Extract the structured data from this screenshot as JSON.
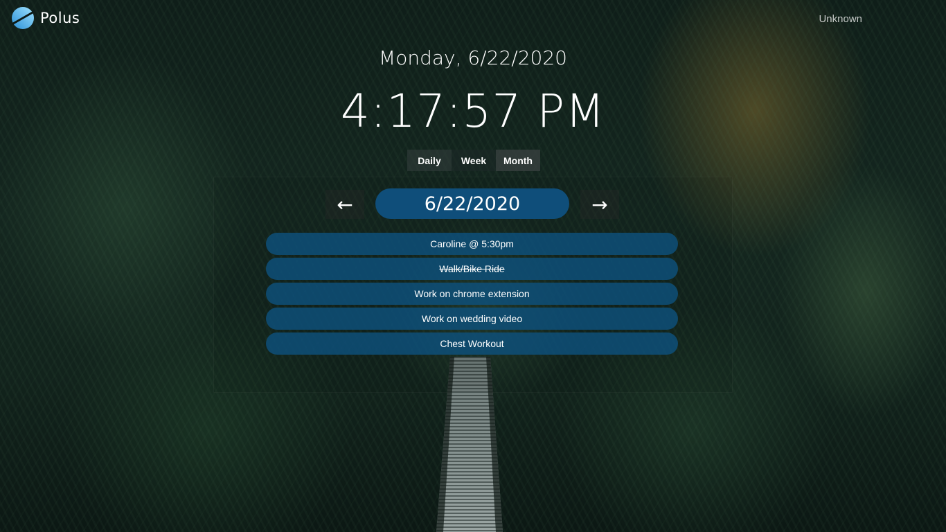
{
  "app": {
    "name": "Polus"
  },
  "user": {
    "name": "Unknown"
  },
  "datetime": {
    "date_line": "Monday, 6/22/2020",
    "time": "4:17:57 PM"
  },
  "view_tabs": [
    {
      "label": "Daily",
      "active": true
    },
    {
      "label": "Week",
      "active": false
    },
    {
      "label": "Month",
      "active": false
    }
  ],
  "navigator": {
    "prev_glyph": "←",
    "next_glyph": "→",
    "current_date": "6/22/2020"
  },
  "tasks": [
    {
      "label": "Caroline @ 5:30pm",
      "done": false
    },
    {
      "label": "Walk/Bike Ride",
      "done": true
    },
    {
      "label": "Work on chrome extension",
      "done": false
    },
    {
      "label": "Work on wedding video",
      "done": false
    },
    {
      "label": "Chest Workout",
      "done": false
    }
  ],
  "colors": {
    "accent": "#0f4e7a",
    "task_background": "#0e507d",
    "logo_gradient_start": "#2a8fd6",
    "logo_gradient_end": "#9fe3ff"
  },
  "icons": {
    "logo": "planet-icon",
    "prev": "arrow-left-icon",
    "next": "arrow-right-icon"
  }
}
